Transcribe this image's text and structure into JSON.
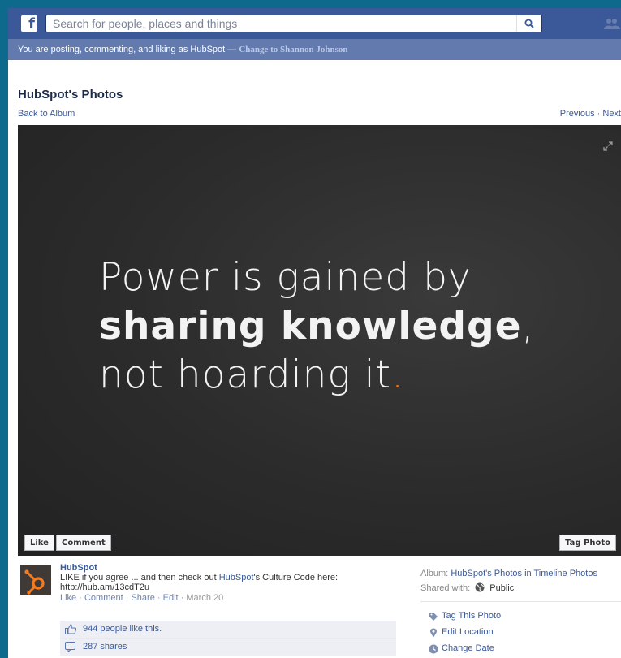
{
  "topbar": {
    "logo_text": "f",
    "search_placeholder": "Search for people, places and things"
  },
  "banner": {
    "text": "You are posting, commenting, and liking as HubSpot — ",
    "switch_link": "Change to Shannon Johnson"
  },
  "photo_page": {
    "title": "HubSpot's Photos",
    "back_link": "Back to Album",
    "prev_link": "Previous",
    "next_link": "Next",
    "nav_separator": "·"
  },
  "photo": {
    "quote_line1": "Power is gained by",
    "quote_line2_strong": "sharing knowledge",
    "quote_line2_tail": ",",
    "quote_line3": "not hoarding it",
    "quote_end": ".",
    "like_button": "Like",
    "comment_button": "Comment",
    "tag_button": "Tag Photo",
    "accent_color": "#f47b20"
  },
  "post": {
    "author": "HubSpot",
    "text_before_link": "LIKE if you agree ... and then check out ",
    "text_link": "HubSpot",
    "text_after_link": "'s Culture Code here: http://hub.am/13cdT2u",
    "actions": {
      "like": "Like",
      "comment": "Comment",
      "share": "Share",
      "edit": "Edit",
      "date": "March 20",
      "separator": "·"
    },
    "likes_text": "944 people like this.",
    "shares_text": "287 shares"
  },
  "sidebar": {
    "album_label": "Album:",
    "album_value": "HubSpot's Photos in Timeline Photos",
    "shared_label": "Shared with:",
    "shared_value": "Public",
    "actions": [
      "Tag This Photo",
      "Edit Location",
      "Change Date"
    ]
  },
  "colors": {
    "facebook_blue": "#3b5998",
    "banner_blue": "#627aad",
    "page_background": "#0e6a8c",
    "photo_background": "#2b2b2b"
  }
}
